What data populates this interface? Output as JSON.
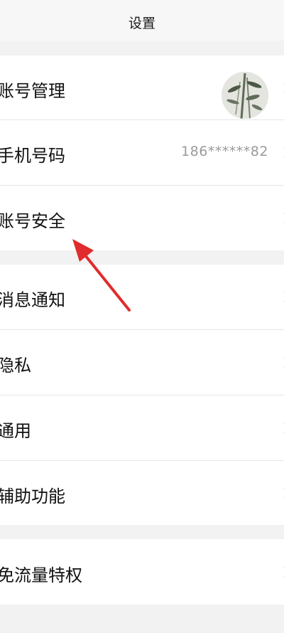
{
  "header": {
    "title": "设置"
  },
  "groups": [
    {
      "rows": [
        {
          "label": "账号管理",
          "has_avatar": true
        },
        {
          "label": "手机号码",
          "value": "186******82"
        },
        {
          "label": "账号安全"
        }
      ]
    },
    {
      "rows": [
        {
          "label": "消息通知"
        },
        {
          "label": "隐私"
        },
        {
          "label": "通用"
        },
        {
          "label": "辅助功能"
        }
      ]
    },
    {
      "rows": [
        {
          "label": "免流量特权"
        }
      ]
    }
  ],
  "colors": {
    "page_bg": "#f2f2f2",
    "row_bg": "#ffffff",
    "text": "#111111",
    "secondary_text": "#9a9a9a",
    "annotation_arrow": "#e02c2c"
  }
}
